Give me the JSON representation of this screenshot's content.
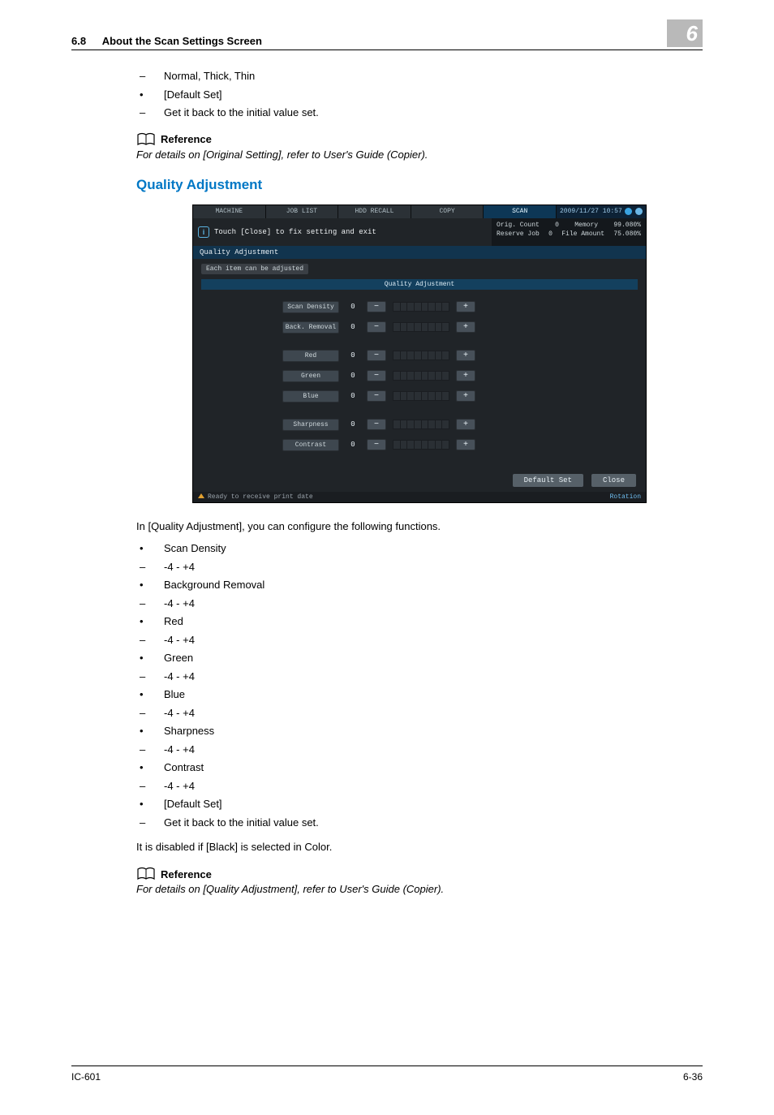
{
  "header": {
    "section_number": "6.8",
    "section_title": "About the Scan Settings Screen",
    "chapter": "6"
  },
  "top_list": [
    {
      "marker": "dash",
      "text": "Normal, Thick, Thin"
    },
    {
      "marker": "dot",
      "text": "[Default Set]"
    },
    {
      "marker": "dash",
      "text": "Get it back to the initial value set."
    }
  ],
  "ref1": {
    "label": "Reference",
    "text": "For details on [Original Setting], refer to User's Guide (Copier)."
  },
  "heading": "Quality Adjustment",
  "panel": {
    "tabs": [
      "MACHINE",
      "JOB LIST",
      "HDD RECALL",
      "COPY",
      "SCAN"
    ],
    "timestamp": "2009/11/27 10:57",
    "info_msg": "Touch [Close] to fix setting and exit",
    "stats": {
      "orig_count_label": "Orig. Count",
      "orig_count": "0",
      "memory_label": "Memory",
      "memory": "99.080%",
      "reserve_label": "Reserve Job",
      "reserve": "0",
      "file_label": "File Amount",
      "file": "75.080%"
    },
    "q_head": "Quality Adjustment",
    "sub_head": "Each item can be adjusted",
    "mid_title": "Quality Adjustment",
    "rows": [
      {
        "label": "Scan Density",
        "value": "0"
      },
      {
        "label": "Back. Removal",
        "value": "0"
      },
      {
        "label": "Red",
        "value": "0"
      },
      {
        "label": "Green",
        "value": "0"
      },
      {
        "label": "Blue",
        "value": "0"
      },
      {
        "label": "Sharpness",
        "value": "0"
      },
      {
        "label": "Contrast",
        "value": "0"
      }
    ],
    "minus": "−",
    "plus": "+",
    "default_btn": "Default Set",
    "close_btn": "Close",
    "status_left": "Ready to receive print date",
    "status_right": "Rotation"
  },
  "intro": "In [Quality Adjustment], you can configure the following functions.",
  "func_list": [
    {
      "marker": "dot",
      "text": "Scan Density"
    },
    {
      "marker": "dash",
      "text": "-4 - +4"
    },
    {
      "marker": "dot",
      "text": "Background Removal"
    },
    {
      "marker": "dash",
      "text": "-4 - +4"
    },
    {
      "marker": "dot",
      "text": "Red"
    },
    {
      "marker": "dash",
      "text": "-4 - +4"
    },
    {
      "marker": "dot",
      "text": "Green"
    },
    {
      "marker": "dash",
      "text": "-4 - +4"
    },
    {
      "marker": "dot",
      "text": "Blue"
    },
    {
      "marker": "dash",
      "text": "-4 - +4"
    },
    {
      "marker": "dot",
      "text": "Sharpness"
    },
    {
      "marker": "dash",
      "text": "-4 - +4"
    },
    {
      "marker": "dot",
      "text": "Contrast"
    },
    {
      "marker": "dash",
      "text": "-4 - +4"
    },
    {
      "marker": "dot",
      "text": "[Default Set]"
    },
    {
      "marker": "dash",
      "text": "Get it back to the initial value set."
    }
  ],
  "note": "It is disabled if [Black] is selected in Color.",
  "ref2": {
    "label": "Reference",
    "text": "For details on [Quality Adjustment], refer to User's Guide (Copier)."
  },
  "footer": {
    "left": "IC-601",
    "right": "6-36"
  }
}
